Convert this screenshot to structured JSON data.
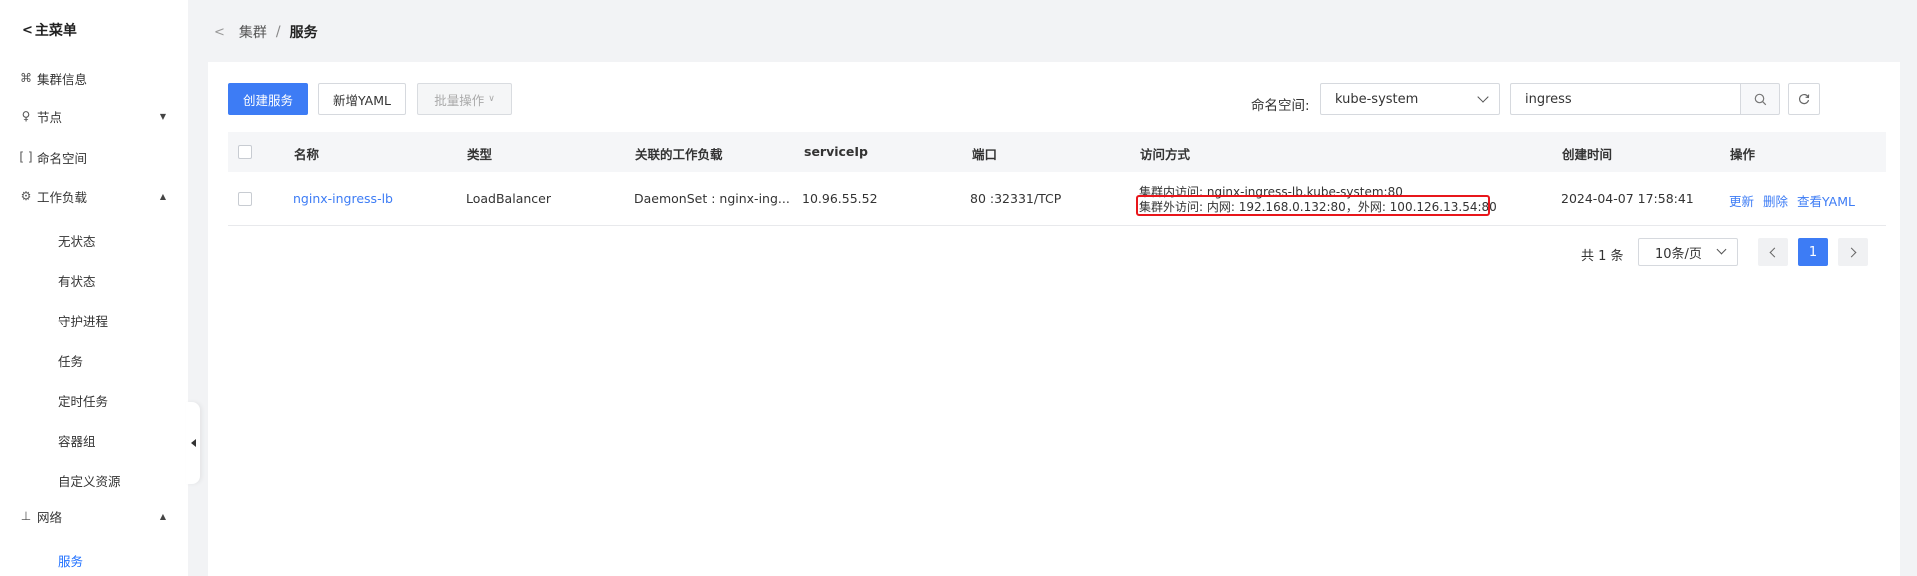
{
  "sidebar": {
    "back_label": "主菜单",
    "items": [
      {
        "label": "集群信息"
      },
      {
        "label": "节点"
      },
      {
        "label": "命名空间"
      },
      {
        "label": "工作负载"
      },
      {
        "label": "网络"
      }
    ],
    "workload_children": [
      "无状态",
      "有状态",
      "守护进程",
      "任务",
      "定时任务",
      "容器组",
      "自定义资源"
    ],
    "network_children": [
      "服务"
    ]
  },
  "breadcrumb": {
    "parent": "集群",
    "separator": "/",
    "current": "服务"
  },
  "toolbar": {
    "create_label": "创建服务",
    "add_yaml_label": "新增YAML",
    "batch_label": "批量操作",
    "namespace_label": "命名空间:",
    "namespace_value": "kube-system",
    "search_value": "ingress"
  },
  "table": {
    "headers": [
      "名称",
      "类型",
      "关联的工作负载",
      "serviceIp",
      "端口",
      "访问方式",
      "创建时间",
      "操作"
    ],
    "rows": [
      {
        "name": "nginx-ingress-lb",
        "type": "LoadBalancer",
        "workload": "DaemonSet : nginx-ing...",
        "service_ip": "10.96.55.52",
        "port": "80 :32331/TCP",
        "access_internal": "集群内访问: nginx-ingress-lb.kube-system:80",
        "access_external": "集群外访问: 内网: 192.168.0.132:80，外网: 100.126.13.54:80",
        "created": "2024-04-07 17:58:41",
        "actions": {
          "update": "更新",
          "delete": "删除",
          "view_yaml": "查看YAML"
        }
      }
    ]
  },
  "pagination": {
    "total_text": "共 1 条",
    "page_size": "10条/页",
    "current_page": "1"
  },
  "colors": {
    "accent": "#3d7cf5",
    "highlight": "#e8161b"
  }
}
